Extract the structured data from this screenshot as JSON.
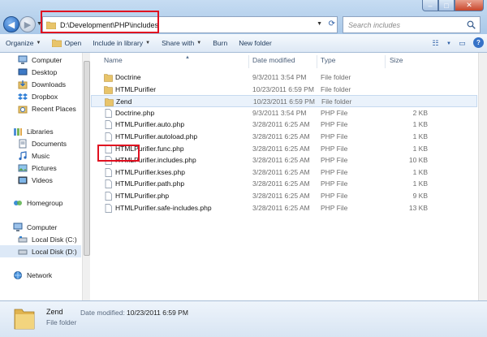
{
  "address": {
    "path": "D:\\Development\\PHP\\includes"
  },
  "search": {
    "placeholder": "Search includes"
  },
  "toolbar": {
    "organize": "Organize",
    "open": "Open",
    "include": "Include in library",
    "share": "Share with",
    "burn": "Burn",
    "new_folder": "New folder"
  },
  "nav": {
    "computer": "Computer",
    "desktop": "Desktop",
    "downloads": "Downloads",
    "dropbox": "Dropbox",
    "recent": "Recent Places",
    "libraries": "Libraries",
    "documents": "Documents",
    "music": "Music",
    "pictures": "Pictures",
    "videos": "Videos",
    "homegroup": "Homegroup",
    "computer2": "Computer",
    "local_c": "Local Disk (C:)",
    "local_d": "Local Disk (D:)",
    "network": "Network"
  },
  "columns": {
    "name": "Name",
    "date": "Date modified",
    "type": "Type",
    "size": "Size"
  },
  "files": [
    {
      "name": "Doctrine",
      "date": "9/3/2011 3:54 PM",
      "type": "File folder",
      "size": "",
      "kind": "folder"
    },
    {
      "name": "HTMLPurifier",
      "date": "10/23/2011 6:59 PM",
      "type": "File folder",
      "size": "",
      "kind": "folder"
    },
    {
      "name": "Zend",
      "date": "10/23/2011 6:59 PM",
      "type": "File folder",
      "size": "",
      "kind": "folder"
    },
    {
      "name": "Doctrine.php",
      "date": "9/3/2011 3:54 PM",
      "type": "PHP File",
      "size": "2 KB",
      "kind": "file"
    },
    {
      "name": "HTMLPurifier.auto.php",
      "date": "3/28/2011 6:25 AM",
      "type": "PHP File",
      "size": "1 KB",
      "kind": "file"
    },
    {
      "name": "HTMLPurifier.autoload.php",
      "date": "3/28/2011 6:25 AM",
      "type": "PHP File",
      "size": "1 KB",
      "kind": "file"
    },
    {
      "name": "HTMLPurifier.func.php",
      "date": "3/28/2011 6:25 AM",
      "type": "PHP File",
      "size": "1 KB",
      "kind": "file"
    },
    {
      "name": "HTMLPurifier.includes.php",
      "date": "3/28/2011 6:25 AM",
      "type": "PHP File",
      "size": "10 KB",
      "kind": "file"
    },
    {
      "name": "HTMLPurifier.kses.php",
      "date": "3/28/2011 6:25 AM",
      "type": "PHP File",
      "size": "1 KB",
      "kind": "file"
    },
    {
      "name": "HTMLPurifier.path.php",
      "date": "3/28/2011 6:25 AM",
      "type": "PHP File",
      "size": "1 KB",
      "kind": "file"
    },
    {
      "name": "HTMLPurifier.php",
      "date": "3/28/2011 6:25 AM",
      "type": "PHP File",
      "size": "9 KB",
      "kind": "file"
    },
    {
      "name": "HTMLPurifier.safe-includes.php",
      "date": "3/28/2011 6:25 AM",
      "type": "PHP File",
      "size": "13 KB",
      "kind": "file"
    }
  ],
  "details": {
    "name": "Zend",
    "type": "File folder",
    "date_label": "Date modified:",
    "date": "10/23/2011 6:59 PM"
  },
  "colors": {
    "highlight": "#e01020",
    "folder": "#e8c46a",
    "selection": "#eaf2fb"
  }
}
